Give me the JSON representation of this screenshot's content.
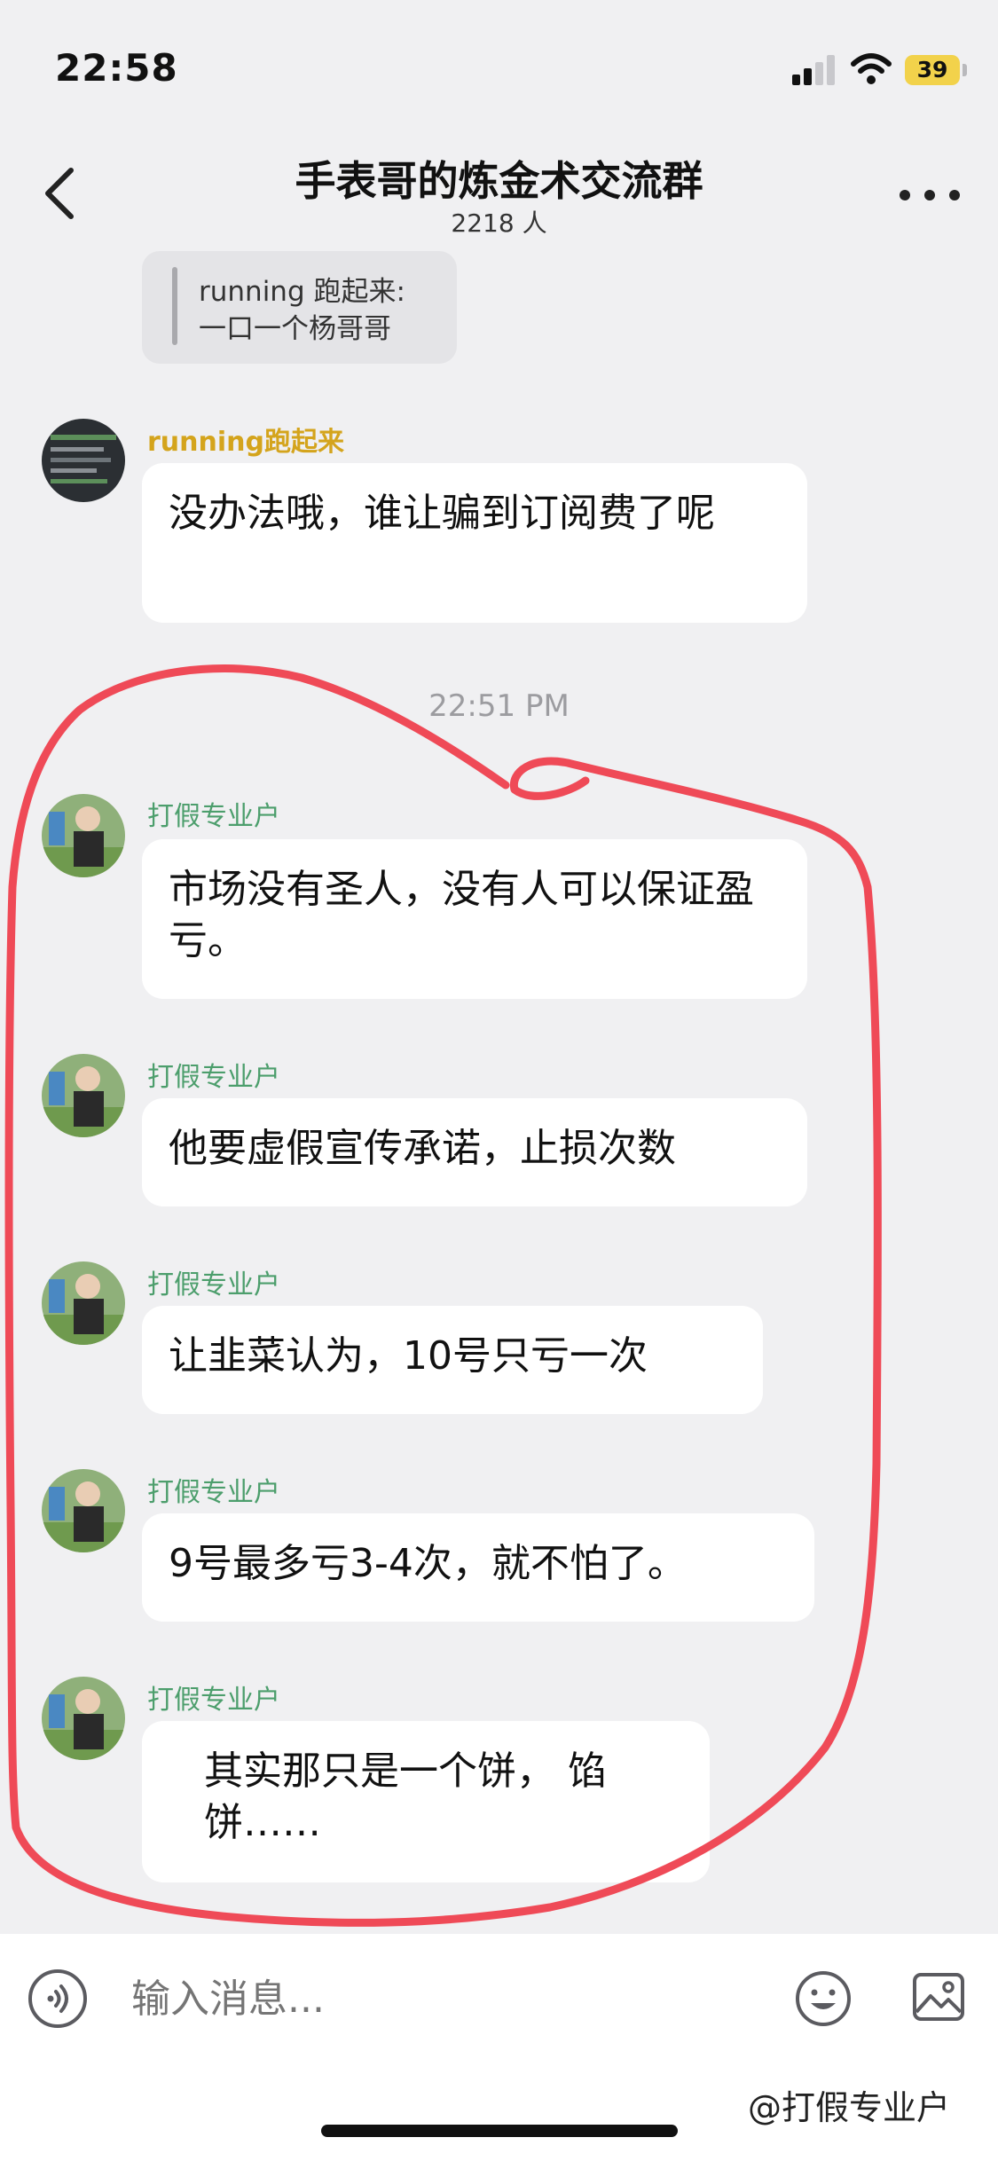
{
  "status_bar": {
    "time": "22:58",
    "battery": "39"
  },
  "header": {
    "title": "手表哥的炼金术交流群",
    "member_count": "2218 人"
  },
  "quote": {
    "author": "running 跑起来:",
    "text": "一口一个杨哥哥"
  },
  "messages": [
    {
      "sender": "running跑起来",
      "text": "没办法哦，谁让骗到订阅费了呢"
    },
    {
      "sender": "打假专业户",
      "text": "市场没有圣人，没有人可以保证盈亏。"
    },
    {
      "sender": "打假专业户",
      "text": "他要虚假宣传承诺，止损次数"
    },
    {
      "sender": "打假专业户",
      "text": "让韭菜认为，10号只亏一次"
    },
    {
      "sender": "打假专业户",
      "text": "9号最多亏3-4次，就不怕了。"
    },
    {
      "sender": "打假专业户",
      "text": "其实那只是一个饼， 馅饼……"
    }
  ],
  "time_separator": "22:51 PM",
  "input": {
    "placeholder": "输入消息..."
  },
  "watermark": "@打假专业户",
  "colors": {
    "background": "#f0f0f2",
    "sender_gold": "#d4a41c",
    "sender_green": "#4c9e6c",
    "annotation_red": "#ef4a57",
    "battery": "#f2d24b"
  },
  "icons": [
    "back-arrow-icon",
    "more-dots-icon",
    "signal-icon",
    "wifi-icon",
    "battery-icon",
    "voice-icon",
    "emoji-icon",
    "image-icon"
  ]
}
